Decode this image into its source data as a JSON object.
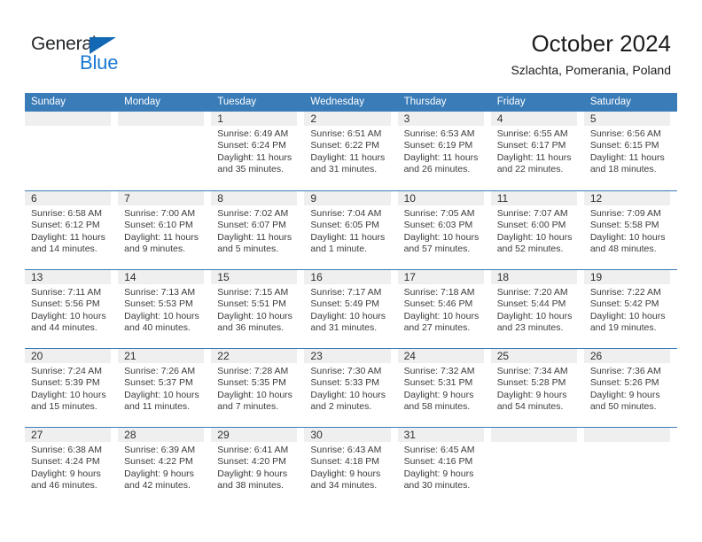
{
  "brand": {
    "name_top": "General",
    "name_bottom": "Blue",
    "triangle_icon": "blue-triangle-icon",
    "color_dark": "#25282a",
    "color_blue": "#1b7ad1"
  },
  "header": {
    "title": "October 2024",
    "subtitle": "Szlachta, Pomerania, Poland"
  },
  "theme": {
    "header_bg": "#3a7cb8",
    "day_band_bg": "#efefef",
    "row_divider": "#3a7cb8",
    "text": "#3c3c3c"
  },
  "weekdays": [
    "Sunday",
    "Monday",
    "Tuesday",
    "Wednesday",
    "Thursday",
    "Friday",
    "Saturday"
  ],
  "weeks": [
    [
      {
        "day": "",
        "sunrise": "",
        "sunset": "",
        "daylight1": "",
        "daylight2": ""
      },
      {
        "day": "",
        "sunrise": "",
        "sunset": "",
        "daylight1": "",
        "daylight2": ""
      },
      {
        "day": "1",
        "sunrise": "Sunrise: 6:49 AM",
        "sunset": "Sunset: 6:24 PM",
        "daylight1": "Daylight: 11 hours",
        "daylight2": "and 35 minutes."
      },
      {
        "day": "2",
        "sunrise": "Sunrise: 6:51 AM",
        "sunset": "Sunset: 6:22 PM",
        "daylight1": "Daylight: 11 hours",
        "daylight2": "and 31 minutes."
      },
      {
        "day": "3",
        "sunrise": "Sunrise: 6:53 AM",
        "sunset": "Sunset: 6:19 PM",
        "daylight1": "Daylight: 11 hours",
        "daylight2": "and 26 minutes."
      },
      {
        "day": "4",
        "sunrise": "Sunrise: 6:55 AM",
        "sunset": "Sunset: 6:17 PM",
        "daylight1": "Daylight: 11 hours",
        "daylight2": "and 22 minutes."
      },
      {
        "day": "5",
        "sunrise": "Sunrise: 6:56 AM",
        "sunset": "Sunset: 6:15 PM",
        "daylight1": "Daylight: 11 hours",
        "daylight2": "and 18 minutes."
      }
    ],
    [
      {
        "day": "6",
        "sunrise": "Sunrise: 6:58 AM",
        "sunset": "Sunset: 6:12 PM",
        "daylight1": "Daylight: 11 hours",
        "daylight2": "and 14 minutes."
      },
      {
        "day": "7",
        "sunrise": "Sunrise: 7:00 AM",
        "sunset": "Sunset: 6:10 PM",
        "daylight1": "Daylight: 11 hours",
        "daylight2": "and 9 minutes."
      },
      {
        "day": "8",
        "sunrise": "Sunrise: 7:02 AM",
        "sunset": "Sunset: 6:07 PM",
        "daylight1": "Daylight: 11 hours",
        "daylight2": "and 5 minutes."
      },
      {
        "day": "9",
        "sunrise": "Sunrise: 7:04 AM",
        "sunset": "Sunset: 6:05 PM",
        "daylight1": "Daylight: 11 hours",
        "daylight2": "and 1 minute."
      },
      {
        "day": "10",
        "sunrise": "Sunrise: 7:05 AM",
        "sunset": "Sunset: 6:03 PM",
        "daylight1": "Daylight: 10 hours",
        "daylight2": "and 57 minutes."
      },
      {
        "day": "11",
        "sunrise": "Sunrise: 7:07 AM",
        "sunset": "Sunset: 6:00 PM",
        "daylight1": "Daylight: 10 hours",
        "daylight2": "and 52 minutes."
      },
      {
        "day": "12",
        "sunrise": "Sunrise: 7:09 AM",
        "sunset": "Sunset: 5:58 PM",
        "daylight1": "Daylight: 10 hours",
        "daylight2": "and 48 minutes."
      }
    ],
    [
      {
        "day": "13",
        "sunrise": "Sunrise: 7:11 AM",
        "sunset": "Sunset: 5:56 PM",
        "daylight1": "Daylight: 10 hours",
        "daylight2": "and 44 minutes."
      },
      {
        "day": "14",
        "sunrise": "Sunrise: 7:13 AM",
        "sunset": "Sunset: 5:53 PM",
        "daylight1": "Daylight: 10 hours",
        "daylight2": "and 40 minutes."
      },
      {
        "day": "15",
        "sunrise": "Sunrise: 7:15 AM",
        "sunset": "Sunset: 5:51 PM",
        "daylight1": "Daylight: 10 hours",
        "daylight2": "and 36 minutes."
      },
      {
        "day": "16",
        "sunrise": "Sunrise: 7:17 AM",
        "sunset": "Sunset: 5:49 PM",
        "daylight1": "Daylight: 10 hours",
        "daylight2": "and 31 minutes."
      },
      {
        "day": "17",
        "sunrise": "Sunrise: 7:18 AM",
        "sunset": "Sunset: 5:46 PM",
        "daylight1": "Daylight: 10 hours",
        "daylight2": "and 27 minutes."
      },
      {
        "day": "18",
        "sunrise": "Sunrise: 7:20 AM",
        "sunset": "Sunset: 5:44 PM",
        "daylight1": "Daylight: 10 hours",
        "daylight2": "and 23 minutes."
      },
      {
        "day": "19",
        "sunrise": "Sunrise: 7:22 AM",
        "sunset": "Sunset: 5:42 PM",
        "daylight1": "Daylight: 10 hours",
        "daylight2": "and 19 minutes."
      }
    ],
    [
      {
        "day": "20",
        "sunrise": "Sunrise: 7:24 AM",
        "sunset": "Sunset: 5:39 PM",
        "daylight1": "Daylight: 10 hours",
        "daylight2": "and 15 minutes."
      },
      {
        "day": "21",
        "sunrise": "Sunrise: 7:26 AM",
        "sunset": "Sunset: 5:37 PM",
        "daylight1": "Daylight: 10 hours",
        "daylight2": "and 11 minutes."
      },
      {
        "day": "22",
        "sunrise": "Sunrise: 7:28 AM",
        "sunset": "Sunset: 5:35 PM",
        "daylight1": "Daylight: 10 hours",
        "daylight2": "and 7 minutes."
      },
      {
        "day": "23",
        "sunrise": "Sunrise: 7:30 AM",
        "sunset": "Sunset: 5:33 PM",
        "daylight1": "Daylight: 10 hours",
        "daylight2": "and 2 minutes."
      },
      {
        "day": "24",
        "sunrise": "Sunrise: 7:32 AM",
        "sunset": "Sunset: 5:31 PM",
        "daylight1": "Daylight: 9 hours",
        "daylight2": "and 58 minutes."
      },
      {
        "day": "25",
        "sunrise": "Sunrise: 7:34 AM",
        "sunset": "Sunset: 5:28 PM",
        "daylight1": "Daylight: 9 hours",
        "daylight2": "and 54 minutes."
      },
      {
        "day": "26",
        "sunrise": "Sunrise: 7:36 AM",
        "sunset": "Sunset: 5:26 PM",
        "daylight1": "Daylight: 9 hours",
        "daylight2": "and 50 minutes."
      }
    ],
    [
      {
        "day": "27",
        "sunrise": "Sunrise: 6:38 AM",
        "sunset": "Sunset: 4:24 PM",
        "daylight1": "Daylight: 9 hours",
        "daylight2": "and 46 minutes."
      },
      {
        "day": "28",
        "sunrise": "Sunrise: 6:39 AM",
        "sunset": "Sunset: 4:22 PM",
        "daylight1": "Daylight: 9 hours",
        "daylight2": "and 42 minutes."
      },
      {
        "day": "29",
        "sunrise": "Sunrise: 6:41 AM",
        "sunset": "Sunset: 4:20 PM",
        "daylight1": "Daylight: 9 hours",
        "daylight2": "and 38 minutes."
      },
      {
        "day": "30",
        "sunrise": "Sunrise: 6:43 AM",
        "sunset": "Sunset: 4:18 PM",
        "daylight1": "Daylight: 9 hours",
        "daylight2": "and 34 minutes."
      },
      {
        "day": "31",
        "sunrise": "Sunrise: 6:45 AM",
        "sunset": "Sunset: 4:16 PM",
        "daylight1": "Daylight: 9 hours",
        "daylight2": "and 30 minutes."
      },
      {
        "day": "",
        "sunrise": "",
        "sunset": "",
        "daylight1": "",
        "daylight2": ""
      },
      {
        "day": "",
        "sunrise": "",
        "sunset": "",
        "daylight1": "",
        "daylight2": ""
      }
    ]
  ]
}
